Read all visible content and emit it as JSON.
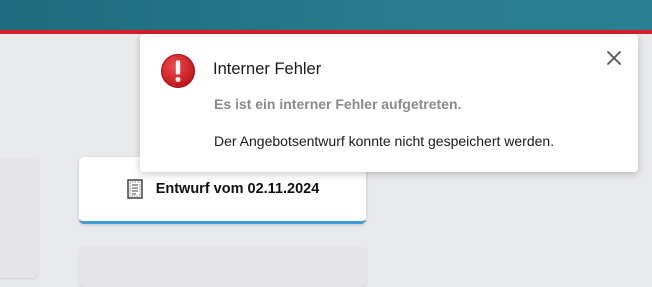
{
  "colors": {
    "header_bar": "#2a7b8e",
    "accent_red": "#d81f26",
    "error_icon": "#d8222a",
    "active_underline": "#3f9ad6",
    "page_background": "#e9eaec"
  },
  "notification": {
    "icon": "error-circle-icon",
    "title": "Interner Fehler",
    "subtitle": "Es ist ein interner Fehler aufgetreten.",
    "message": "Der Angebotsentwurf konnte nicht gespeichert werden.",
    "close_icon": "close-icon"
  },
  "draft_card": {
    "icon": "document-icon",
    "title": "Entwurf vom 02.11.2024"
  }
}
